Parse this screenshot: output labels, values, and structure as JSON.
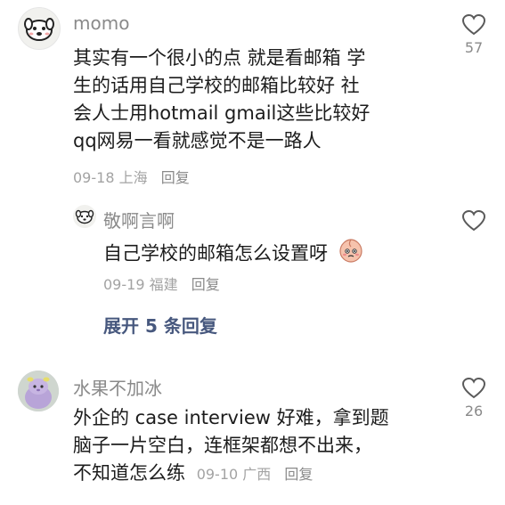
{
  "comments": [
    {
      "username": "momo",
      "lines": [
        "其实有一个很小的点 就是看邮箱 学",
        "生的话用自己学校的邮箱比较好 社",
        "会人士用hotmail gmail这些比较好",
        "qq网易一看就感觉不是一路人"
      ],
      "date": "09-18",
      "location": "上海",
      "reply_label": "回复",
      "likes": "57",
      "avatar_icon": "cartoon-dog-avatar",
      "replies": [
        {
          "username": "敬啊言啊",
          "text": "自己学校的邮箱怎么设置呀",
          "date": "09-19",
          "location": "福建",
          "reply_label": "回复",
          "avatar_icon": "cartoon-dog-avatar-small",
          "emoji": "peach-face-emoji"
        }
      ],
      "expand_label": "展开 5 条回复"
    },
    {
      "username": "水果不加冰",
      "lines": [
        "外企的 case interview 好难，拿到题",
        "脑子一片空白，连框架都想不出来，",
        "不知道怎么练"
      ],
      "date": "09-10",
      "location": "广西",
      "reply_label": "回复",
      "likes": "26",
      "avatar_icon": "plush-toy-avatar"
    }
  ],
  "colors": {
    "username": "#8a8a8a",
    "body": "#1c1c1c",
    "meta": "#a3a3a3",
    "expand": "#47587e"
  }
}
